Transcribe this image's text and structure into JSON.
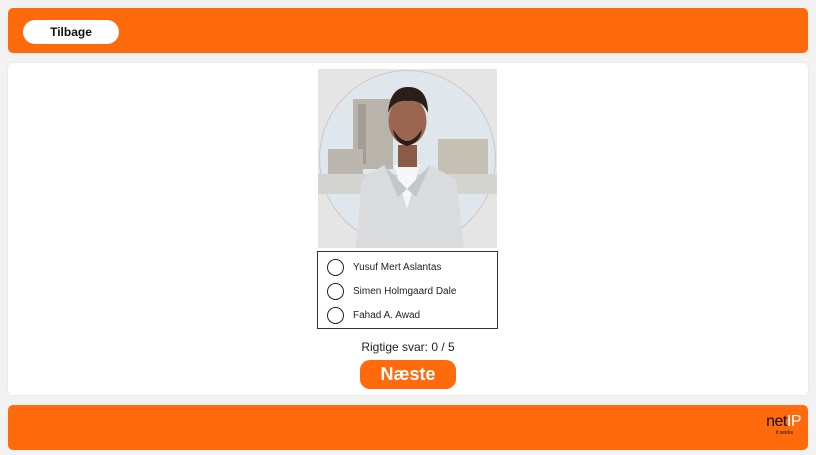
{
  "header": {
    "back_label": "Tilbage"
  },
  "quiz": {
    "photo_icon": "person-portrait",
    "options": [
      {
        "label": "Yusuf Mert Aslantas"
      },
      {
        "label": "Simen Holmgaard Dale"
      },
      {
        "label": "Fahad A. Awad"
      }
    ],
    "score_label": "Rigtige svar: 0 / 5",
    "next_label": "Næste"
  },
  "footer": {
    "logo_net": "net",
    "logo_ip": "IP",
    "logo_tagline": "it works"
  },
  "colors": {
    "brand_orange": "#ff6a0d",
    "card_background": "#ffffff",
    "page_background": "#f2f2f2"
  }
}
